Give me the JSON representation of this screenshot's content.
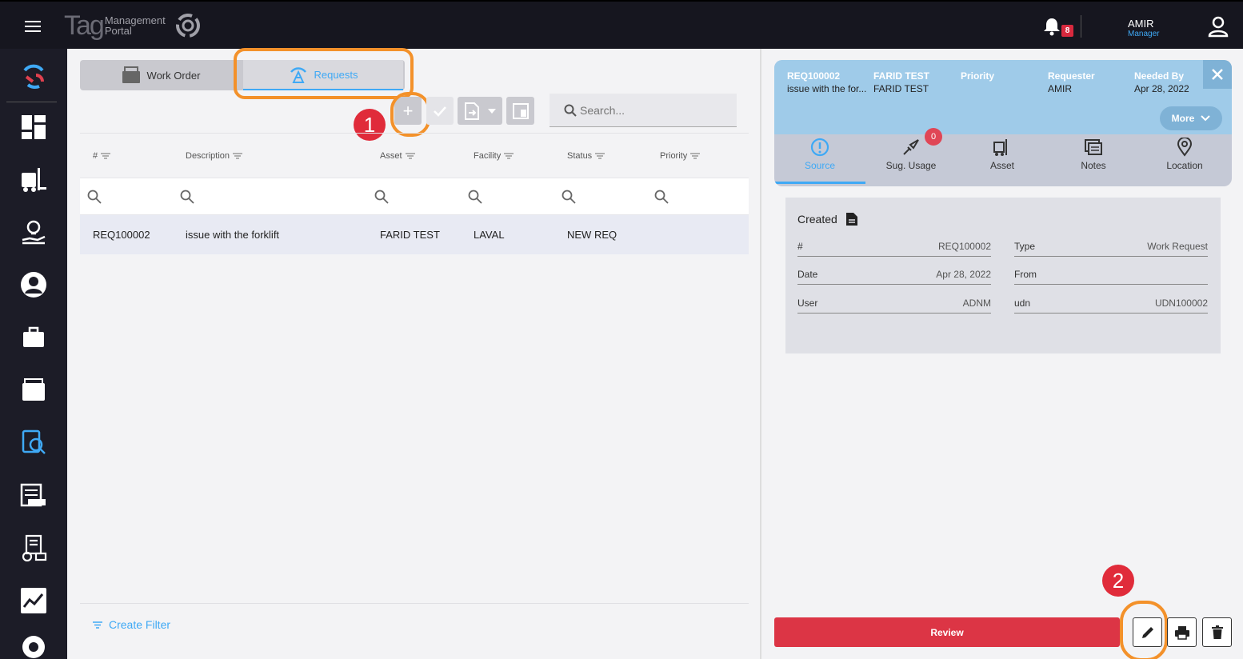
{
  "app": {
    "logo_tag": "Tag",
    "logo_line1": "Management",
    "logo_line2": "Portal",
    "notification_count": "8",
    "user_name": "AMIR",
    "user_role": "Manager"
  },
  "sidebar": {
    "icons": [
      "tag-logo-icon",
      "dashboard-icon",
      "forklift-icon",
      "lightbulb-hand-icon",
      "user-circle-icon",
      "briefcase-icon",
      "folder-icon",
      "search-report-icon",
      "list-icon",
      "report-gauge-icon",
      "line-chart-icon",
      "gear-icon"
    ]
  },
  "tabs": {
    "work_order": "Work Order",
    "requests": "Requests"
  },
  "toolbar": {
    "add": "+",
    "search_placeholder": "Search..."
  },
  "grid": {
    "columns": [
      "#",
      "Description",
      "Asset",
      "Facility",
      "Status",
      "Priority"
    ],
    "rows": [
      {
        "id": "REQ100002",
        "description": "issue with the forklift",
        "asset": "FARID TEST",
        "facility": "LAVAL",
        "status": "NEW REQ",
        "priority": ""
      }
    ],
    "create_filter": "Create Filter"
  },
  "annotations": {
    "step1": "1",
    "step2": "2",
    "highlight_color": "#f3912a"
  },
  "detail": {
    "header": [
      {
        "label": "REQ100002",
        "value": "issue with the for..."
      },
      {
        "label": "FARID TEST",
        "value": "FARID TEST"
      },
      {
        "label": "Priority",
        "value": ""
      },
      {
        "label": "Requester",
        "value": "AMIR"
      },
      {
        "label": "Needed By",
        "value": "Apr 28, 2022"
      }
    ],
    "more": "More",
    "tabs": [
      "Source",
      "Sug. Usage",
      "Asset",
      "Notes",
      "Location"
    ],
    "usage_badge": "0",
    "card_title": "Created",
    "fields_left": [
      {
        "k": "#",
        "v": "REQ100002"
      },
      {
        "k": "Date",
        "v": "Apr 28, 2022"
      },
      {
        "k": "User",
        "v": "ADNM"
      }
    ],
    "fields_right": [
      {
        "k": "Type",
        "v": "Work Request"
      },
      {
        "k": "From",
        "v": ""
      },
      {
        "k": "udn",
        "v": "UDN100002"
      }
    ],
    "review": "Review"
  },
  "colors": {
    "accent": "#3fa9f5",
    "danger": "#dc3545",
    "topbar": "#16161f"
  }
}
